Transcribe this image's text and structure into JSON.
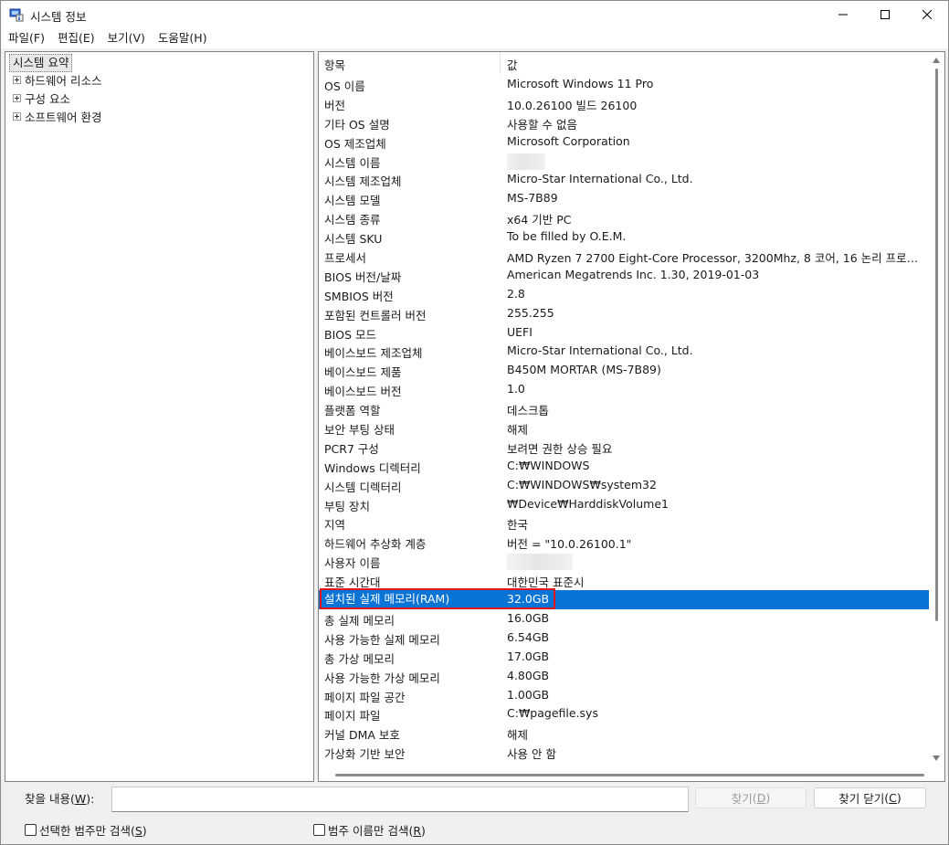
{
  "window": {
    "title": "시스템 정보"
  },
  "menu": [
    "파일(F)",
    "편집(E)",
    "보기(V)",
    "도움말(H)"
  ],
  "tree": {
    "root": "시스템 요약",
    "items": [
      "하드웨어 리소스",
      "구성 요소",
      "소프트웨어 환경"
    ]
  },
  "list": {
    "header": {
      "item": "항목",
      "value": "값"
    },
    "rows": [
      {
        "item": "OS 이름",
        "value": "Microsoft Windows 11 Pro"
      },
      {
        "item": "버전",
        "value": "10.0.26100 빌드 26100"
      },
      {
        "item": "기타 OS 설명",
        "value": "사용할 수 없음"
      },
      {
        "item": "OS 제조업체",
        "value": "Microsoft Corporation"
      },
      {
        "item": "시스템 이름",
        "value": ""
      },
      {
        "item": "시스템 제조업체",
        "value": "Micro-Star International Co., Ltd."
      },
      {
        "item": "시스템 모델",
        "value": "MS-7B89"
      },
      {
        "item": "시스템 종류",
        "value": "x64 기반 PC"
      },
      {
        "item": "시스템 SKU",
        "value": "To be filled by O.E.M."
      },
      {
        "item": "프로세서",
        "value": "AMD Ryzen 7 2700 Eight-Core Processor, 3200Mhz, 8 코어, 16 논리 프로세..."
      },
      {
        "item": "BIOS 버전/날짜",
        "value": "American Megatrends Inc. 1.30, 2019-01-03"
      },
      {
        "item": "SMBIOS 버전",
        "value": "2.8"
      },
      {
        "item": "포함된 컨트롤러 버전",
        "value": "255.255"
      },
      {
        "item": "BIOS 모드",
        "value": "UEFI"
      },
      {
        "item": "베이스보드 제조업체",
        "value": "Micro-Star International Co., Ltd."
      },
      {
        "item": "베이스보드 제품",
        "value": "B450M MORTAR (MS-7B89)"
      },
      {
        "item": "베이스보드 버전",
        "value": "1.0"
      },
      {
        "item": "플랫폼 역할",
        "value": "데스크톱"
      },
      {
        "item": "보안 부팅 상태",
        "value": "해제"
      },
      {
        "item": "PCR7 구성",
        "value": "보려면 권한 상승 필요"
      },
      {
        "item": "Windows 디렉터리",
        "value": "C:₩WINDOWS"
      },
      {
        "item": "시스템 디렉터리",
        "value": "C:₩WINDOWS₩system32"
      },
      {
        "item": "부팅 장치",
        "value": "₩Device₩HarddiskVolume1"
      },
      {
        "item": "지역",
        "value": "한국"
      },
      {
        "item": "하드웨어 추상화 계층",
        "value": "버전 = \"10.0.26100.1\""
      },
      {
        "item": "사용자 이름",
        "value": ""
      },
      {
        "item": "표준 시간대",
        "value": "대한민국 표준시"
      },
      {
        "item": "설치된 실제 메모리(RAM)",
        "value": "32.0GB"
      },
      {
        "item": "총 실제 메모리",
        "value": "16.0GB"
      },
      {
        "item": "사용 가능한 실제 메모리",
        "value": "6.54GB"
      },
      {
        "item": "총 가상 메모리",
        "value": "17.0GB"
      },
      {
        "item": "사용 가능한 가상 메모리",
        "value": "4.80GB"
      },
      {
        "item": "페이지 파일 공간",
        "value": "1.00GB"
      },
      {
        "item": "페이지 파일",
        "value": "C:₩pagefile.sys"
      },
      {
        "item": "커널 DMA 보호",
        "value": "해제"
      },
      {
        "item": "가상화 기반 보안",
        "value": "사용 안 함"
      }
    ],
    "selected_index": 27
  },
  "find": {
    "label": "찾을 내용",
    "label_key": "W",
    "input_value": "",
    "find_button": "찾기",
    "find_key": "D",
    "close_button": "찾기 닫기",
    "close_key": "C",
    "check_selected": "선택한 범주만 검색",
    "check_selected_key": "S",
    "check_selected_checked": false,
    "check_names": "범주 이름만 검색",
    "check_names_key": "R",
    "check_names_checked": false
  },
  "colors": {
    "selection": "#0a74d6",
    "highlight_border": "#e0161e"
  },
  "icons": {
    "app": "system-information-icon",
    "minimize": "minimize-icon",
    "maximize": "maximize-icon",
    "close": "close-icon"
  }
}
